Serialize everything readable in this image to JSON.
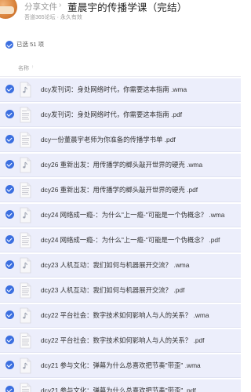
{
  "header": {
    "breadcrumb": "分享文件",
    "separator": "›",
    "title": "董晨宇的传播学课（完结）",
    "subline": "吾道365论坛 · 永久有效"
  },
  "selection": {
    "text": "已选 51 项"
  },
  "list_header": {
    "name_col": "名称",
    "sort_icon": "↑"
  },
  "files": [
    {
      "name": "dcy发刊词：身处网络时代，你需要这本指南 .wma",
      "type": "audio"
    },
    {
      "name": "dcy发刊词：身处网络时代，你需要这本指南 .pdf",
      "type": "pdf"
    },
    {
      "name": "dcy一份董晨宇老师为你准备的传播学书单 .pdf",
      "type": "pdf"
    },
    {
      "name": "dcy26 重新出发：用传播学的榔头敲开世界的硬壳 .wma",
      "type": "audio"
    },
    {
      "name": "dcy26 重新出发：用传播学的榔头敲开世界的硬壳 .pdf",
      "type": "pdf"
    },
    {
      "name": "dcy24 网络成一瘾-：为什么\"上一瘾-\"可能是一个伪概念？ .wma",
      "type": "audio"
    },
    {
      "name": "dcy24 网络成一瘾-：为什么\"上一瘾-\"可能是一个伪概念？ .pdf",
      "type": "pdf"
    },
    {
      "name": "dcy23 人机互动：我们如何与机器展开交流？ .wma",
      "type": "audio"
    },
    {
      "name": "dcy23 人机互动：我们如何与机器展开交流？ .pdf",
      "type": "pdf"
    },
    {
      "name": "dcy22 平台社会：数字技术如何影响人与人的关系？ .wma",
      "type": "audio"
    },
    {
      "name": "dcy22 平台社会：数字技术如何影响人与人的关系？ .pdf",
      "type": "pdf"
    },
    {
      "name": "dcy21 参与文化：弹幕为什么总喜欢把节奏\"带歪\" .wma",
      "type": "audio"
    },
    {
      "name": "dcy21 参与文化：弹幕为什么总喜欢把节奏\"带歪\" .pdf",
      "type": "pdf"
    }
  ]
}
